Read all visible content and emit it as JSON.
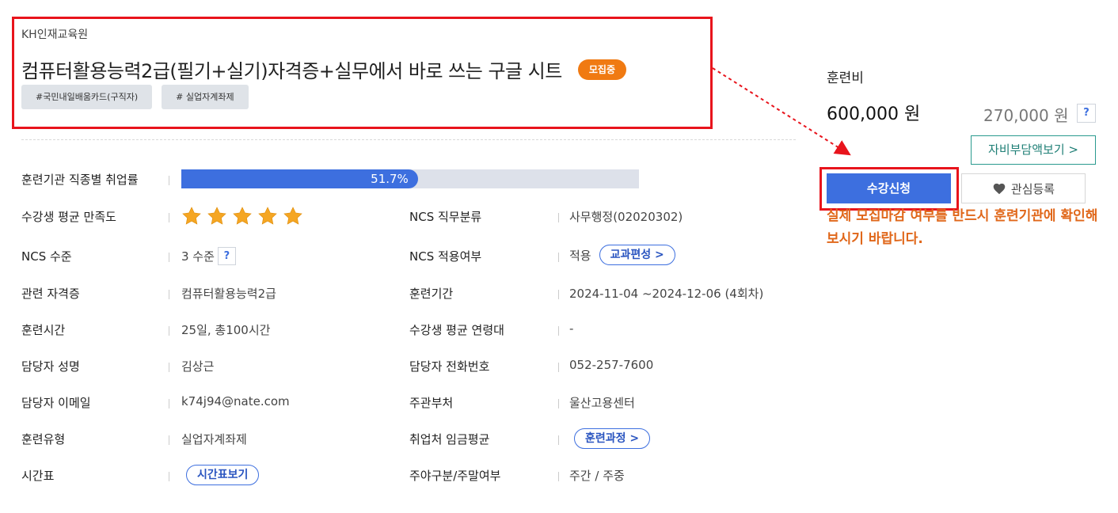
{
  "course": {
    "org": "KH인재교육원",
    "title": "컴퓨터활용능력2급(필기+실기)자격증+실무에서 바로 쓰는 구글 시트",
    "status": "모집중",
    "tags": [
      "#국민내일배움카드(구직자)",
      "# 실업자계좌제"
    ]
  },
  "info": {
    "employment_rate": {
      "label": "훈련기관 직종별 취업률",
      "value": "51.7%",
      "fraction": 0.517
    },
    "satisfaction": {
      "label": "수강생 평균 만족도",
      "stars": 5
    },
    "ncs_job": {
      "label": "NCS 직무분류",
      "value": "사무행정(02020302)"
    },
    "ncs_level": {
      "label": "NCS 수준",
      "value": "3 수준",
      "help": "?"
    },
    "ncs_apply": {
      "label": "NCS 적용여부",
      "value": "적용",
      "button": "교과편성 >"
    },
    "cert": {
      "label": "관련 자격증",
      "value": "컴퓨터활용능력2급"
    },
    "period": {
      "label": "훈련기간",
      "value": "2024-11-04 ~2024-12-06 (4회차)"
    },
    "hours": {
      "label": "훈련시간",
      "value": "25일, 총100시간"
    },
    "age": {
      "label": "수강생 평균 연령대",
      "value": "-"
    },
    "manager": {
      "label": "담당자 성명",
      "value": "김상근"
    },
    "phone": {
      "label": "담당자 전화번호",
      "value": "052-257-7600"
    },
    "email": {
      "label": "담당자 이메일",
      "value": "k74j94@nate.com"
    },
    "dept": {
      "label": "주관부처",
      "value": "울산고용센터"
    },
    "type": {
      "label": "훈련유형",
      "value": "실업자계좌제"
    },
    "wage": {
      "label": "취업처 임금평균",
      "button": "훈련과정 >"
    },
    "schedule": {
      "label": "시간표",
      "button": "시간표보기"
    },
    "daynight": {
      "label": "주야구분/주말여부",
      "value": "주간 / 주중"
    }
  },
  "fee": {
    "label": "훈련비",
    "original": "600,000 원",
    "self_pay": "270,000 원",
    "help": "?",
    "selfpay_button": "자비부담액보기 >"
  },
  "actions": {
    "apply": "수강신청",
    "wishlist": "관심등록",
    "notice": "실제 모집마감 여부를 반드시 훈련기관에 확인해보시기 바랍니다."
  },
  "colors": {
    "primary": "#3d6fdf",
    "status": "#f07a12",
    "highlight": "#e8141c",
    "notice": "#e0671a",
    "star": "#f5a623"
  }
}
